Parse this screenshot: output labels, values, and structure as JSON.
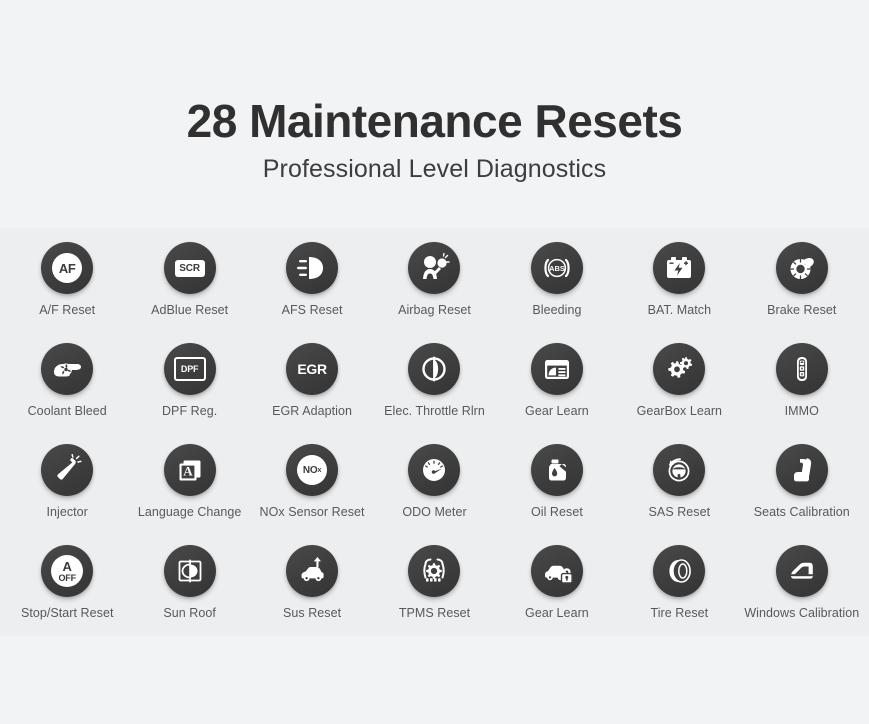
{
  "header": {
    "title": "28 Maintenance Resets",
    "subtitle": "Professional Level Diagnostics"
  },
  "colors": {
    "page_background": "#f2f3f5",
    "band_background": "#eceef0",
    "icon_circle": "#3f3f3f",
    "icon_glyph": "#ffffff",
    "title_text": "#303030",
    "label_text": "#57595d"
  },
  "grid": {
    "columns": 7,
    "rows": 4,
    "total": 28
  },
  "items": [
    {
      "label": "A/F Reset",
      "icon": "af-badge-icon",
      "badge": "AF"
    },
    {
      "label": "AdBlue Reset",
      "icon": "scr-badge-icon",
      "badge": "SCR"
    },
    {
      "label": "AFS Reset",
      "icon": "headlight-icon",
      "badge": ""
    },
    {
      "label": "Airbag Reset",
      "icon": "airbag-occupant-icon",
      "badge": ""
    },
    {
      "label": "Bleeding",
      "icon": "abs-brake-icon",
      "badge": "ABS"
    },
    {
      "label": "BAT. Match",
      "icon": "battery-icon",
      "badge": ""
    },
    {
      "label": "Brake Reset",
      "icon": "brake-disc-icon",
      "badge": ""
    },
    {
      "label": "Coolant Bleed",
      "icon": "coolant-fan-icon",
      "badge": ""
    },
    {
      "label": "DPF Reg.",
      "icon": "dpf-filter-icon",
      "badge": "DPF"
    },
    {
      "label": "EGR Adaption",
      "icon": "egr-text-icon",
      "badge": "EGR"
    },
    {
      "label": "Elec. Throttle Rlrn",
      "icon": "throttle-body-icon",
      "badge": ""
    },
    {
      "label": "Gear Learn",
      "icon": "gear-learn-screen-icon",
      "badge": ""
    },
    {
      "label": "GearBox Learn",
      "icon": "gears-icon",
      "badge": ""
    },
    {
      "label": "IMMO",
      "icon": "key-fob-icon",
      "badge": ""
    },
    {
      "label": "Injector",
      "icon": "fuel-injector-icon",
      "badge": ""
    },
    {
      "label": "Language Change",
      "icon": "language-a-icon",
      "badge": "A"
    },
    {
      "label": "NOx Sensor Reset",
      "icon": "nox-badge-icon",
      "badge": "NOx"
    },
    {
      "label": "ODO Meter",
      "icon": "odometer-gauge-icon",
      "badge": ""
    },
    {
      "label": "Oil Reset",
      "icon": "oil-can-icon",
      "badge": ""
    },
    {
      "label": "SAS Reset",
      "icon": "steering-angle-icon",
      "badge": ""
    },
    {
      "label": "Seats Calibration",
      "icon": "car-seat-icon",
      "badge": ""
    },
    {
      "label": "Stop/Start Reset",
      "icon": "auto-stop-off-icon",
      "badge": "A OFF"
    },
    {
      "label": "Sun Roof",
      "icon": "sunroof-icon",
      "badge": ""
    },
    {
      "label": "Sus Reset",
      "icon": "suspension-car-icon",
      "badge": ""
    },
    {
      "label": "TPMS Reset",
      "icon": "tpms-tire-pressure-icon",
      "badge": ""
    },
    {
      "label": "Gear Learn",
      "icon": "car-lock-icon",
      "badge": ""
    },
    {
      "label": "Tire Reset",
      "icon": "tire-icon",
      "badge": ""
    },
    {
      "label": "Windows Calibration",
      "icon": "car-window-icon",
      "badge": ""
    }
  ]
}
